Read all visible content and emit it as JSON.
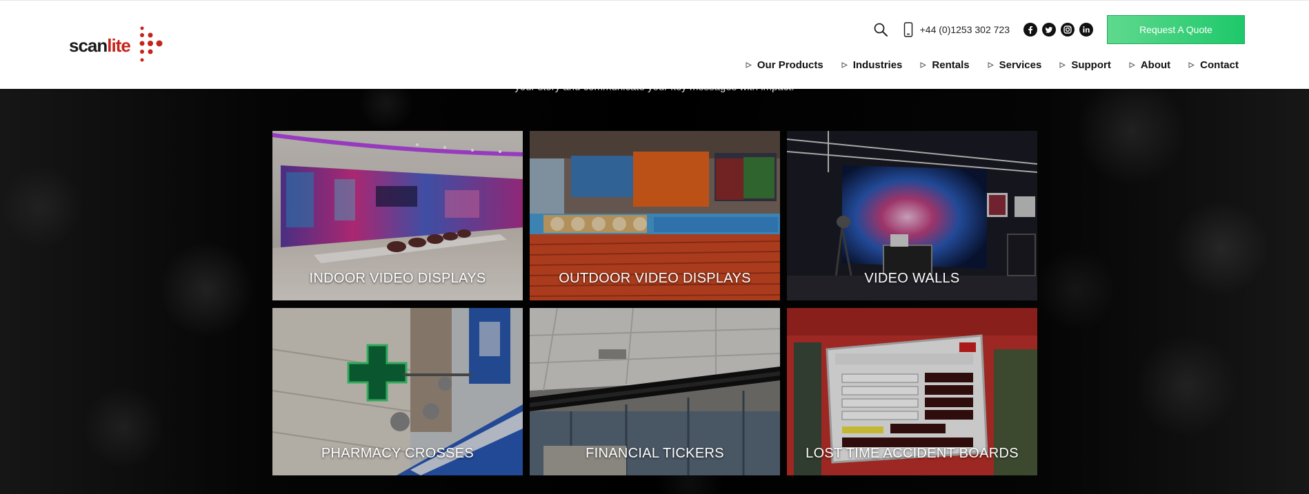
{
  "brand": {
    "logo_main": "scan",
    "logo_accent": "lite",
    "accent_color": "#c4241b"
  },
  "header": {
    "phone": "+44 (0)1253 302 723",
    "social": [
      "facebook-icon",
      "twitter-icon",
      "instagram-icon",
      "linkedin-icon"
    ],
    "quote_label": "Request A Quote",
    "quote_color": "#1ec86a"
  },
  "nav": {
    "items": [
      "Our Products",
      "Industries",
      "Rentals",
      "Services",
      "Support",
      "About",
      "Contact"
    ]
  },
  "intro": {
    "text": "your story and communicate your key messages with impact."
  },
  "tiles": [
    {
      "label": "INDOOR VIDEO DISPLAYS"
    },
    {
      "label": "OUTDOOR VIDEO DISPLAYS"
    },
    {
      "label": "VIDEO WALLS"
    },
    {
      "label": "PHARMACY CROSSES"
    },
    {
      "label": "FINANCIAL TICKERS"
    },
    {
      "label": "LOST TIME ACCIDENT BOARDS"
    }
  ]
}
